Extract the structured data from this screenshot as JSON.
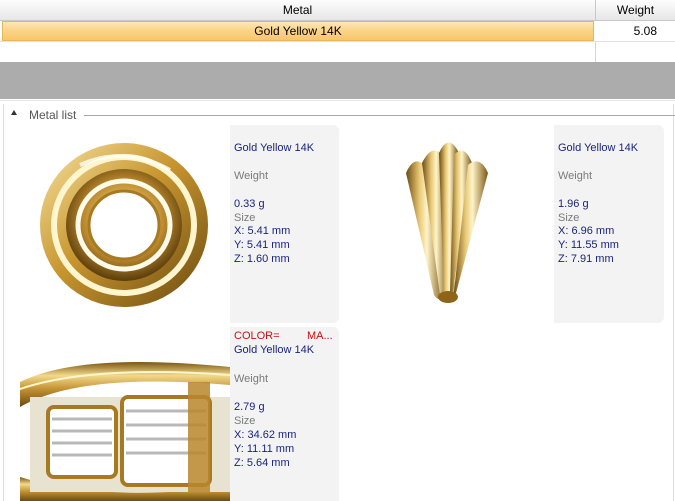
{
  "grid": {
    "columns": [
      "Metal",
      "Weight"
    ],
    "rows": [
      {
        "metal": "Gold Yellow 14K",
        "weight": "5.08"
      }
    ]
  },
  "group": {
    "label": "Metal list"
  },
  "cards": [
    {
      "shape": "ring-bead-icon",
      "color_label": "",
      "color_value": "",
      "metal": "Gold Yellow 14K",
      "weight_label": "Weight",
      "weight": "0.33 g",
      "size_label": "Size",
      "x": "X: 5.41 mm",
      "y": "Y: 5.41 mm",
      "z": "Z: 1.60 mm"
    },
    {
      "shape": "prong-setting-icon",
      "color_label": "",
      "color_value": "",
      "metal": "Gold Yellow 14K",
      "weight_label": "Weight",
      "weight": "1.96 g",
      "size_label": "Size",
      "x": "X: 6.96 mm",
      "y": "Y: 11.55 mm",
      "z": "Z: 7.91 mm"
    },
    {
      "shape": "ring-shank-icon",
      "color_label": "COLOR=",
      "color_value": "MA...",
      "metal": "Gold Yellow 14K",
      "weight_label": "Weight",
      "weight": "2.79 g",
      "size_label": "Size",
      "x": "X: 34.62 mm",
      "y": "Y: 11.11 mm",
      "z": "Z: 5.64 mm"
    }
  ],
  "colors": {
    "selection": "#fbd58a",
    "info_text": "#1a237e",
    "color_tag": "#c41212",
    "gray_band": "#acacac"
  }
}
